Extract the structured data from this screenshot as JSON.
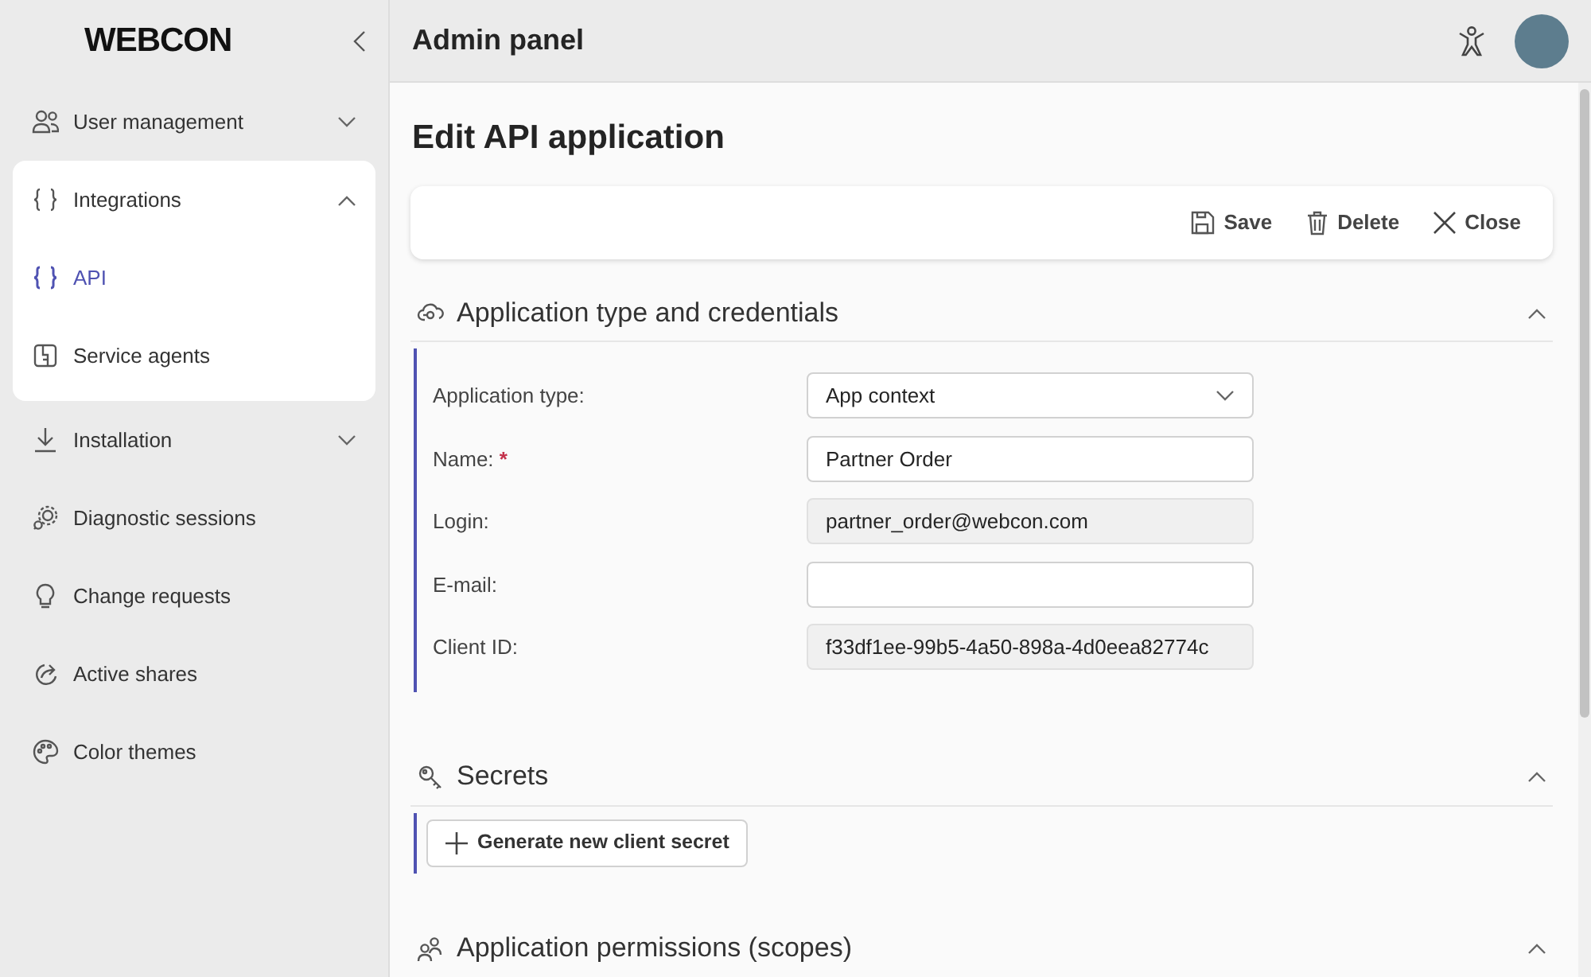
{
  "logo": "WEBCON",
  "header": {
    "title": "Admin panel"
  },
  "sidebar": {
    "items": [
      {
        "label": "User management",
        "expanded": false,
        "selected": false
      },
      {
        "label": "Integrations",
        "expanded": true,
        "selected": false,
        "children": [
          {
            "label": "API",
            "selected": true
          },
          {
            "label": "Service agents",
            "selected": false
          }
        ]
      },
      {
        "label": "Installation",
        "expanded": false,
        "selected": false
      },
      {
        "label": "Diagnostic sessions",
        "selected": false
      },
      {
        "label": "Change requests",
        "selected": false
      },
      {
        "label": "Active shares",
        "selected": false
      },
      {
        "label": "Color themes",
        "selected": false
      }
    ]
  },
  "page_title": "Edit API application",
  "toolbar": [
    "Save",
    "Delete",
    "Close"
  ],
  "sections": [
    {
      "title": "Application type and credentials",
      "expanded": true,
      "fields": [
        {
          "kind": "select",
          "label": "Application type:",
          "value": "App context"
        },
        {
          "kind": "input",
          "label": "Name:",
          "required_mark": "*",
          "value": "Partner Order"
        },
        {
          "kind": "readonly",
          "label": "Login:",
          "value": "partner_order@webcon.com"
        },
        {
          "kind": "input",
          "label": "E-mail:"
        },
        {
          "kind": "readonly",
          "label": "Client ID:",
          "value": "f33df1ee-99b5-4a50-898a-4d0eea82774c"
        }
      ]
    },
    {
      "title": "Secrets",
      "expanded": true,
      "button": "Generate new client secret"
    },
    {
      "title": "Application permissions (scopes)",
      "expanded": true
    }
  ]
}
